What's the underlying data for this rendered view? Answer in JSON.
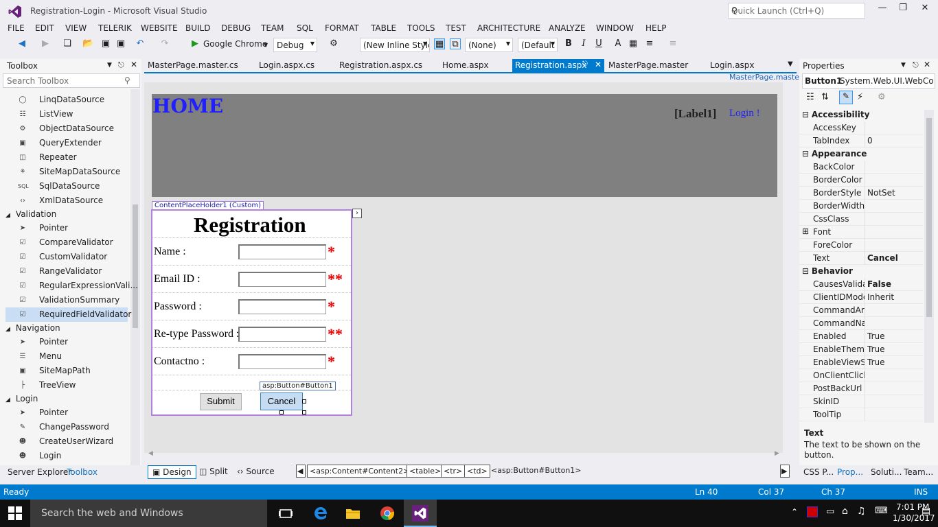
{
  "window": {
    "title": "Registration-Login - Microsoft Visual Studio",
    "quick_launch_placeholder": "Quick Launch (Ctrl+Q)"
  },
  "menu": [
    "FILE",
    "EDIT",
    "VIEW",
    "TELERIK",
    "WEBSITE",
    "BUILD",
    "DEBUG",
    "TEAM",
    "SQL",
    "FORMAT",
    "TABLE",
    "TOOLS",
    "TEST",
    "ARCHITECTURE",
    "ANALYZE",
    "WINDOW",
    "HELP"
  ],
  "toolbar": {
    "run_target": "Google Chrome",
    "config": "Debug",
    "style_combo": "(New Inline Style",
    "target_rule": "(None)",
    "font_combo": "(Default",
    "bold": "B",
    "italic": "I",
    "underline": "U"
  },
  "toolbox": {
    "title": "Toolbox",
    "search_placeholder": "Search Toolbox",
    "items_data": [
      "LinqDataSource",
      "ListView",
      "ObjectDataSource",
      "QueryExtender",
      "Repeater",
      "SiteMapDataSource",
      "SqlDataSource",
      "XmlDataSource"
    ],
    "cat_validation": "Validation",
    "items_validation": [
      "Pointer",
      "CompareValidator",
      "CustomValidator",
      "RangeValidator",
      "RegularExpressionVali...",
      "ValidationSummary",
      "RequiredFieldValidator"
    ],
    "cat_navigation": "Navigation",
    "items_navigation": [
      "Pointer",
      "Menu",
      "SiteMapPath",
      "TreeView"
    ],
    "cat_login": "Login",
    "items_login": [
      "Pointer",
      "ChangePassword",
      "CreateUserWizard",
      "Login"
    ],
    "bottom_tabs": [
      "Server Explorer",
      "Toolbox"
    ]
  },
  "doc_tabs": [
    "MasterPage.master.cs",
    "Login.aspx.cs",
    "Registration.aspx.cs",
    "Home.aspx",
    "Registration.aspx",
    "MasterPage.master",
    "Login.aspx"
  ],
  "master_link": "MasterPage.master",
  "design": {
    "home": "HOME",
    "label1": "[Label1]",
    "login_link": "Login !",
    "cph_tag": "ContentPlaceHolder1 (Custom)",
    "reg_title": "Registration",
    "fields": [
      {
        "label": "Name :",
        "stars": "*"
      },
      {
        "label": "Email ID :",
        "stars": "**"
      },
      {
        "label": "Password :",
        "stars": "*"
      },
      {
        "label": "Re-type Password :",
        "stars": "**"
      },
      {
        "label": "Contactno :",
        "stars": "*"
      }
    ],
    "submit": "Submit",
    "cancel": "Cancel",
    "button_tag": "asp:Button#Button1"
  },
  "view_tabs": [
    "Design",
    "Split",
    "Source"
  ],
  "breadcrumbs": [
    "<asp:Content#Content2>",
    "<table>",
    "<tr>",
    "<td>",
    "<asp:Button#Button1>"
  ],
  "properties": {
    "title": "Properties",
    "object": "Button1",
    "object_type": "System.Web.UI.WebCo",
    "rows": [
      {
        "type": "cat",
        "label": "Accessibility"
      },
      {
        "k": "AccessKey",
        "v": ""
      },
      {
        "k": "TabIndex",
        "v": "0"
      },
      {
        "type": "cat",
        "label": "Appearance"
      },
      {
        "k": "BackColor",
        "v": ""
      },
      {
        "k": "BorderColor",
        "v": ""
      },
      {
        "k": "BorderStyle",
        "v": "NotSet"
      },
      {
        "k": "BorderWidth",
        "v": ""
      },
      {
        "k": "CssClass",
        "v": ""
      },
      {
        "k": "Font",
        "v": ""
      },
      {
        "k": "ForeColor",
        "v": ""
      },
      {
        "k": "Text",
        "v": "Cancel",
        "bold": true
      },
      {
        "type": "cat",
        "label": "Behavior"
      },
      {
        "k": "CausesValidati",
        "v": "False",
        "bold": true
      },
      {
        "k": "ClientIDMode",
        "v": "Inherit"
      },
      {
        "k": "CommandArg",
        "v": ""
      },
      {
        "k": "CommandNar",
        "v": ""
      },
      {
        "k": "Enabled",
        "v": "True"
      },
      {
        "k": "EnableThemin",
        "v": "True"
      },
      {
        "k": "EnableViewSta",
        "v": "True"
      },
      {
        "k": "OnClientClick",
        "v": ""
      },
      {
        "k": "PostBackUrl",
        "v": ""
      },
      {
        "k": "SkinID",
        "v": ""
      },
      {
        "k": "ToolTip",
        "v": ""
      }
    ],
    "desc_title": "Text",
    "desc_text": "The text to be shown on the button.",
    "bottom_tabs": [
      "CSS P...",
      "Prop...",
      "Soluti...",
      "Team..."
    ]
  },
  "status": {
    "ready": "Ready",
    "ln": "Ln 40",
    "col": "Col 37",
    "ch": "Ch 37",
    "ins": "INS"
  },
  "taskbar": {
    "search": "Search the web and Windows",
    "time": "7:01 PM",
    "date": "1/30/2017"
  },
  "colors": {
    "accent": "#007acc",
    "banner": "#808080",
    "link": "#2020ff",
    "required": "#e00000"
  }
}
